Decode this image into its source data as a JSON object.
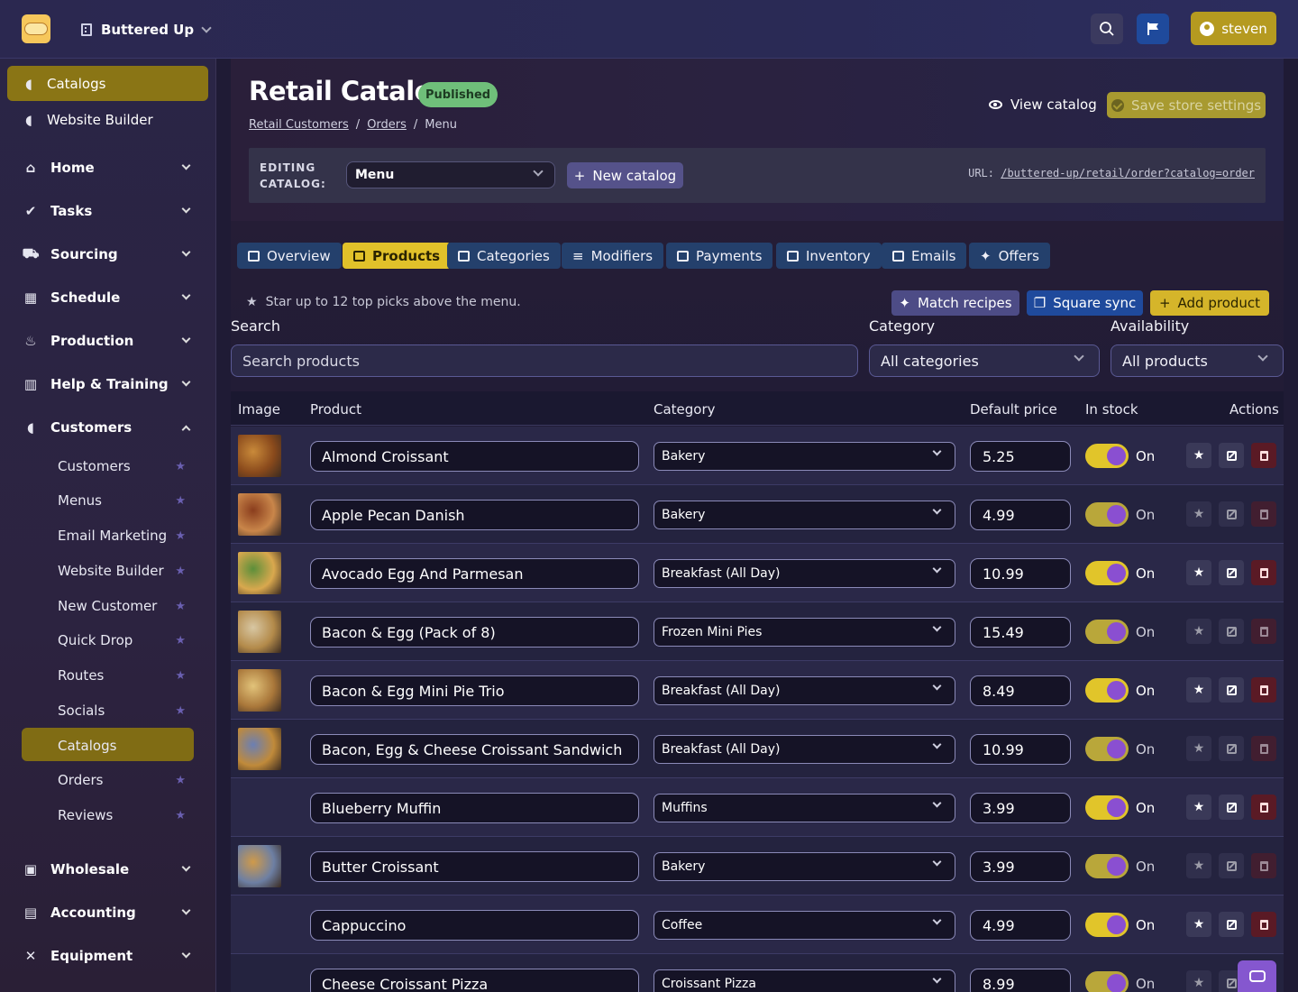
{
  "topbar": {
    "store_name": "Buttered Up",
    "user_name": "steven"
  },
  "sidebar": {
    "pinned": [
      {
        "label": "Catalogs"
      },
      {
        "label": "Website Builder"
      }
    ],
    "sections": [
      {
        "label": "Home"
      },
      {
        "label": "Tasks"
      },
      {
        "label": "Sourcing"
      },
      {
        "label": "Schedule"
      },
      {
        "label": "Production"
      },
      {
        "label": "Help & Training"
      },
      {
        "label": "Customers"
      },
      {
        "label": "Wholesale"
      },
      {
        "label": "Accounting"
      },
      {
        "label": "Equipment"
      }
    ],
    "customers_items": [
      {
        "label": "Customers"
      },
      {
        "label": "Menus"
      },
      {
        "label": "Email Marketing"
      },
      {
        "label": "Website Builder"
      },
      {
        "label": "New Customer"
      },
      {
        "label": "Quick Drop"
      },
      {
        "label": "Routes"
      },
      {
        "label": "Socials"
      },
      {
        "label": "Catalogs"
      },
      {
        "label": "Orders"
      },
      {
        "label": "Reviews"
      }
    ]
  },
  "page": {
    "title": "Retail Catalogs",
    "status_badge": "Published",
    "breadcrumb": [
      "Retail Customers",
      "Orders",
      "Menu"
    ],
    "breadcrumb_sep": "/",
    "view_catalog": "View catalog",
    "save_settings": "Save store settings",
    "editing_label_1": "EDITING",
    "editing_label_2": "CATALOG:",
    "catalog_selected": "Menu",
    "new_catalog": "New catalog",
    "url_label": "URL:",
    "url_value": "/buttered-up/retail/order?catalog=order"
  },
  "tabs": [
    {
      "label": "Overview"
    },
    {
      "label": "Products"
    },
    {
      "label": "Categories"
    },
    {
      "label": "Modifiers"
    },
    {
      "label": "Payments"
    },
    {
      "label": "Inventory"
    },
    {
      "label": "Emails"
    },
    {
      "label": "Offers"
    }
  ],
  "toolbar": {
    "hint": "Star up to 12 top picks above the menu.",
    "match_recipes": "Match recipes",
    "square_sync": "Square sync",
    "add_product": "Add product"
  },
  "filters": {
    "search_label": "Search",
    "search_placeholder": "Search products",
    "category_label": "Category",
    "category_value": "All categories",
    "availability_label": "Availability",
    "availability_value": "All products"
  },
  "table": {
    "headers": {
      "image": "Image",
      "product": "Product",
      "category": "Category",
      "price": "Default price",
      "stock": "In stock",
      "actions": "Actions"
    },
    "rows": [
      {
        "name": "Almond Croissant",
        "category": "Bakery",
        "price": "5.25",
        "stock": "On"
      },
      {
        "name": "Apple Pecan Danish",
        "category": "Bakery",
        "price": "4.99",
        "stock": "On"
      },
      {
        "name": "Avocado Egg And Parmesan",
        "category": "Breakfast (All Day)",
        "price": "10.99",
        "stock": "On"
      },
      {
        "name": "Bacon & Egg (Pack of 8)",
        "category": "Frozen Mini Pies",
        "price": "15.49",
        "stock": "On"
      },
      {
        "name": "Bacon & Egg Mini Pie Trio",
        "category": "Breakfast (All Day)",
        "price": "8.49",
        "stock": "On"
      },
      {
        "name": "Bacon, Egg & Cheese Croissant Sandwich",
        "category": "Breakfast (All Day)",
        "price": "10.99",
        "stock": "On"
      },
      {
        "name": "Blueberry Muffin",
        "category": "Muffins",
        "price": "3.99",
        "stock": "On"
      },
      {
        "name": "Butter Croissant",
        "category": "Bakery",
        "price": "3.99",
        "stock": "On"
      },
      {
        "name": "Cappuccino",
        "category": "Coffee",
        "price": "4.99",
        "stock": "On"
      },
      {
        "name": "Cheese Croissant Pizza",
        "category": "Croissant Pizza",
        "price": "8.99",
        "stock": "On"
      }
    ]
  }
}
